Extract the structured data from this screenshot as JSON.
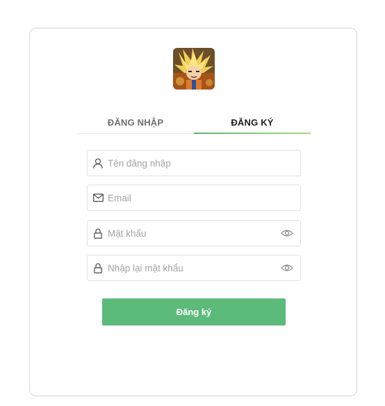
{
  "tabs": {
    "login_label": "ĐĂNG NHẬP",
    "register_label": "ĐĂNG KÝ",
    "active": "register"
  },
  "form": {
    "username_placeholder": "Tên đăng nhập",
    "email_placeholder": "Email",
    "password_placeholder": "Mật khẩu",
    "confirm_password_placeholder": "Nhập lại mật khẩu",
    "submit_label": "Đăng ký"
  },
  "icons": {
    "logo": "game-avatar-logo",
    "username": "user-icon",
    "email": "mail-icon",
    "password": "lock-icon",
    "show_password": "eye-icon"
  },
  "colors": {
    "accent": "#5cba7a",
    "underline_start": "#5ab46c",
    "underline_end": "#a8d98a",
    "border": "#e1e1e1",
    "placeholder": "#a3a3a3"
  }
}
